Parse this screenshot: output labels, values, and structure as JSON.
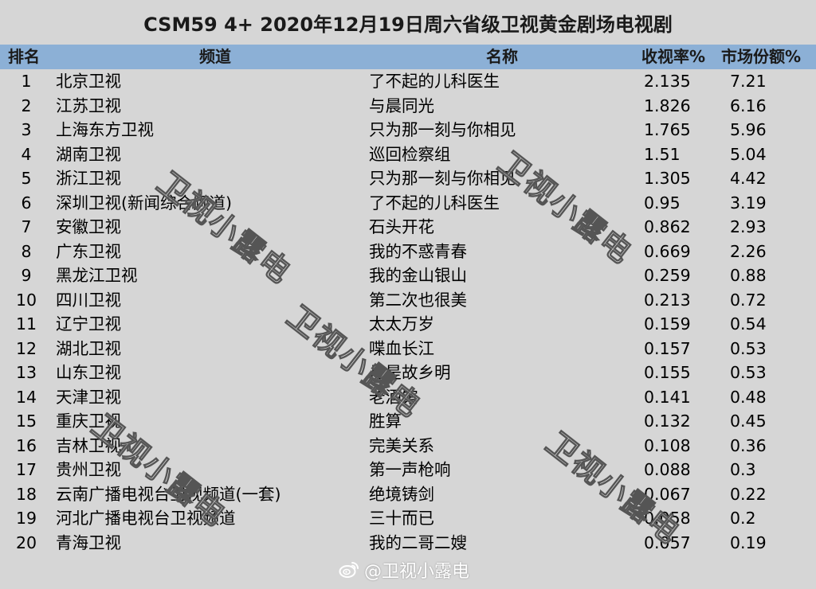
{
  "title": "CSM59 4+ 2020年12月19日周六省级卫视黄金剧场电视剧",
  "columns": {
    "rank": "排名",
    "channel": "频道",
    "name": "名称",
    "rating": "收视率%",
    "share": "市场份额%"
  },
  "rows": [
    {
      "rank": "1",
      "channel": "北京卫视",
      "name": "了不起的儿科医生",
      "rating": "2.135",
      "share": "7.21"
    },
    {
      "rank": "2",
      "channel": "江苏卫视",
      "name": "与晨同光",
      "rating": "1.826",
      "share": "6.16"
    },
    {
      "rank": "3",
      "channel": "上海东方卫视",
      "name": "只为那一刻与你相见",
      "rating": "1.765",
      "share": "5.96"
    },
    {
      "rank": "4",
      "channel": "湖南卫视",
      "name": "巡回检察组",
      "rating": "1.51",
      "share": "5.04"
    },
    {
      "rank": "5",
      "channel": "浙江卫视",
      "name": "只为那一刻与你相见",
      "rating": "1.305",
      "share": "4.42"
    },
    {
      "rank": "6",
      "channel": "深圳卫视(新闻综合频道)",
      "name": "了不起的儿科医生",
      "rating": "0.95",
      "share": "3.19"
    },
    {
      "rank": "7",
      "channel": "安徽卫视",
      "name": "石头开花",
      "rating": "0.862",
      "share": "2.93"
    },
    {
      "rank": "8",
      "channel": "广东卫视",
      "name": "我的不惑青春",
      "rating": "0.669",
      "share": "2.26"
    },
    {
      "rank": "9",
      "channel": "黑龙江卫视",
      "name": "我的金山银山",
      "rating": "0.259",
      "share": "0.88"
    },
    {
      "rank": "10",
      "channel": "四川卫视",
      "name": "第二次也很美",
      "rating": "0.213",
      "share": "0.72"
    },
    {
      "rank": "11",
      "channel": "辽宁卫视",
      "name": "太太万岁",
      "rating": "0.159",
      "share": "0.54"
    },
    {
      "rank": "12",
      "channel": "湖北卫视",
      "name": "喋血长江",
      "rating": "0.157",
      "share": "0.53"
    },
    {
      "rank": "13",
      "channel": "山东卫视",
      "name": "月是故乡明",
      "rating": "0.155",
      "share": "0.53"
    },
    {
      "rank": "14",
      "channel": "天津卫视",
      "name": "老酒馆",
      "rating": "0.141",
      "share": "0.48"
    },
    {
      "rank": "15",
      "channel": "重庆卫视",
      "name": "胜算",
      "rating": "0.132",
      "share": "0.45"
    },
    {
      "rank": "16",
      "channel": "吉林卫视",
      "name": "完美关系",
      "rating": "0.108",
      "share": "0.36"
    },
    {
      "rank": "17",
      "channel": "贵州卫视",
      "name": "第一声枪响",
      "rating": "0.088",
      "share": "0.3"
    },
    {
      "rank": "18",
      "channel": "云南广播电视台卫视频道(一套)",
      "name": "绝境铸剑",
      "rating": "0.067",
      "share": "0.22"
    },
    {
      "rank": "19",
      "channel": "河北广播电视台卫视频道",
      "name": "三十而已",
      "rating": "0.058",
      "share": "0.2"
    },
    {
      "rank": "20",
      "channel": "青海卫视",
      "name": "我的二哥二嫂",
      "rating": "0.057",
      "share": "0.19"
    }
  ],
  "watermark": "卫视小露电",
  "weibo_handle": "@卫视小露电",
  "colors": {
    "background": "#d6d6d6",
    "header_bg": "#8cb0d6"
  },
  "icons": {
    "weibo": "weibo-logo-icon"
  }
}
